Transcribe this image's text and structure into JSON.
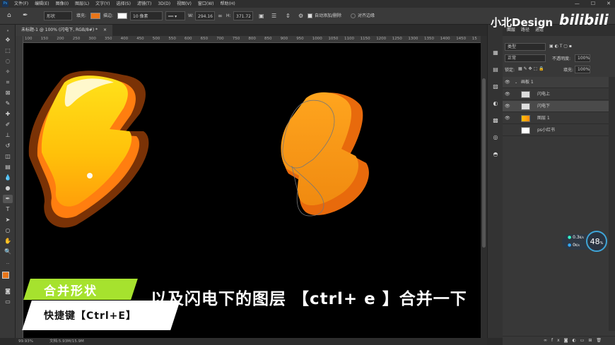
{
  "menubar": {
    "app_icon": "Ps",
    "items": [
      "文件(F)",
      "编辑(E)",
      "图像(I)",
      "图层(L)",
      "文字(Y)",
      "选择(S)",
      "滤镜(T)",
      "3D(D)",
      "视图(V)",
      "窗口(W)",
      "帮助(H)"
    ],
    "window_controls": [
      "—",
      "☐",
      "✕"
    ]
  },
  "options": {
    "shape_mode": "形状",
    "fill_label": "填充:",
    "stroke_label": "描边:",
    "stroke_width": "10 像素",
    "w_label": "W:",
    "w_value": "294.16",
    "h_label": "H:",
    "h_value": "371.72",
    "auto_add_delete": "自动添加/删除",
    "align_edges": "对齐边缘",
    "fill_color": "#e8761a"
  },
  "document": {
    "tab_title": "未标题-1 @ 100% (闪电下, RGB/8#) *",
    "close": "×",
    "ruler_ticks": [
      "100",
      "150",
      "200",
      "250",
      "300",
      "350",
      "400",
      "450",
      "500",
      "550",
      "600",
      "650",
      "700",
      "750",
      "800",
      "850",
      "900",
      "950",
      "1000",
      "1050",
      "1100",
      "1150",
      "1200",
      "1250",
      "1300",
      "1350",
      "1400",
      "1450",
      "15"
    ]
  },
  "status": {
    "zoom": "99.93%",
    "doc_info": "文档:5.93M/15.9M"
  },
  "watermark": {
    "text": "小北Design",
    "logo": "bilibili"
  },
  "panel": {
    "tabs": [
      "图层",
      "路径",
      "通道"
    ],
    "filter_kind": "类型",
    "blend_mode": "正常",
    "opacity_label": "不透明度:",
    "opacity_value": "100%",
    "lock_label": "锁定:",
    "fill_label": "填充:",
    "fill_value": "100%",
    "layers": [
      {
        "name": "画板 1",
        "indent": 0,
        "group": true,
        "selected": false
      },
      {
        "name": "闪电上",
        "indent": 1,
        "group": false,
        "selected": false
      },
      {
        "name": "闪电下",
        "indent": 1,
        "group": false,
        "selected": true
      },
      {
        "name": "图层 1",
        "indent": 1,
        "group": false,
        "selected": false
      },
      {
        "name": "ps小红书",
        "indent": 1,
        "group": false,
        "selected": false
      }
    ],
    "bottom_icons": [
      "link-icon",
      "fx-icon",
      "mask-icon",
      "adjustment-icon",
      "folder-icon",
      "new-layer-icon",
      "trash-icon"
    ]
  },
  "speed_widget": {
    "up": "0.3",
    "up_unit": "K/s",
    "down": "0",
    "down_unit": "K/s",
    "percent": "48",
    "percent_sign": "%"
  },
  "captions": {
    "badge_title": "合并形状",
    "badge_sub": "快捷键【Ctrl+E】",
    "subtitle": "以及闪电下的图层 【ctrl+ e 】合并一下"
  }
}
